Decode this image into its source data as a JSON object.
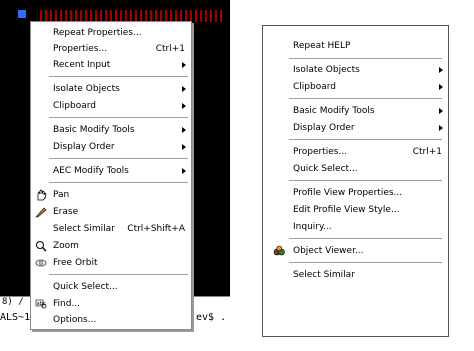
{
  "left_menu": {
    "items": [
      {
        "label": "Repeat Properties...",
        "shortcut": "",
        "submenu": false
      },
      {
        "label": "Properties...",
        "shortcut": "Ctrl+1",
        "submenu": false
      },
      {
        "label": "Recent Input",
        "shortcut": "",
        "submenu": true
      },
      {
        "label": "Isolate Objects",
        "shortcut": "",
        "submenu": true
      },
      {
        "label": "Clipboard",
        "shortcut": "",
        "submenu": true
      },
      {
        "label": "Basic Modify Tools",
        "shortcut": "",
        "submenu": true
      },
      {
        "label": "Display Order",
        "shortcut": "",
        "submenu": true
      },
      {
        "label": "AEC Modify Tools",
        "shortcut": "",
        "submenu": true
      },
      {
        "label": "Pan",
        "shortcut": "",
        "submenu": false,
        "icon": "pan-icon"
      },
      {
        "label": "Erase",
        "shortcut": "",
        "submenu": false,
        "icon": "erase-icon"
      },
      {
        "label": "Select Similar",
        "shortcut": "Ctrl+Shift+A",
        "submenu": false
      },
      {
        "label": "Zoom",
        "shortcut": "",
        "submenu": false,
        "icon": "zoom-icon"
      },
      {
        "label": "Free Orbit",
        "shortcut": "",
        "submenu": false,
        "icon": "orbit-icon"
      },
      {
        "label": "Quick Select...",
        "shortcut": "",
        "submenu": false
      },
      {
        "label": "Find...",
        "shortcut": "",
        "submenu": false,
        "icon": "find-icon"
      },
      {
        "label": "Options...",
        "shortcut": "",
        "submenu": false
      }
    ]
  },
  "right_menu": {
    "items": [
      {
        "label": "Repeat HELP",
        "shortcut": "",
        "submenu": false
      },
      {
        "label": "Isolate Objects",
        "shortcut": "",
        "submenu": true
      },
      {
        "label": "Clipboard",
        "shortcut": "",
        "submenu": true
      },
      {
        "label": "Basic Modify Tools",
        "shortcut": "",
        "submenu": true
      },
      {
        "label": "Display Order",
        "shortcut": "",
        "submenu": true
      },
      {
        "label": "Properties...",
        "shortcut": "Ctrl+1",
        "submenu": false
      },
      {
        "label": "Quick Select...",
        "shortcut": "",
        "submenu": false
      },
      {
        "label": "Profile View Properties...",
        "shortcut": "",
        "submenu": false
      },
      {
        "label": "Edit Profile View Style...",
        "shortcut": "",
        "submenu": false
      },
      {
        "label": "Inquiry...",
        "shortcut": "",
        "submenu": false
      },
      {
        "label": "Object Viewer...",
        "shortcut": "",
        "submenu": false,
        "icon": "object-viewer-icon"
      },
      {
        "label": "Select Similar",
        "shortcut": "",
        "submenu": false
      }
    ]
  },
  "background": {
    "tab_text": "8) /",
    "command_left": "ALS~1",
    "command_right": "ev$ ."
  },
  "colors": {
    "cad_background": "#000000",
    "menu_background": "#ffffff",
    "separator": "#a0a0a0",
    "grip_blue": "#2f6bff",
    "red_markers": "#c00000"
  }
}
